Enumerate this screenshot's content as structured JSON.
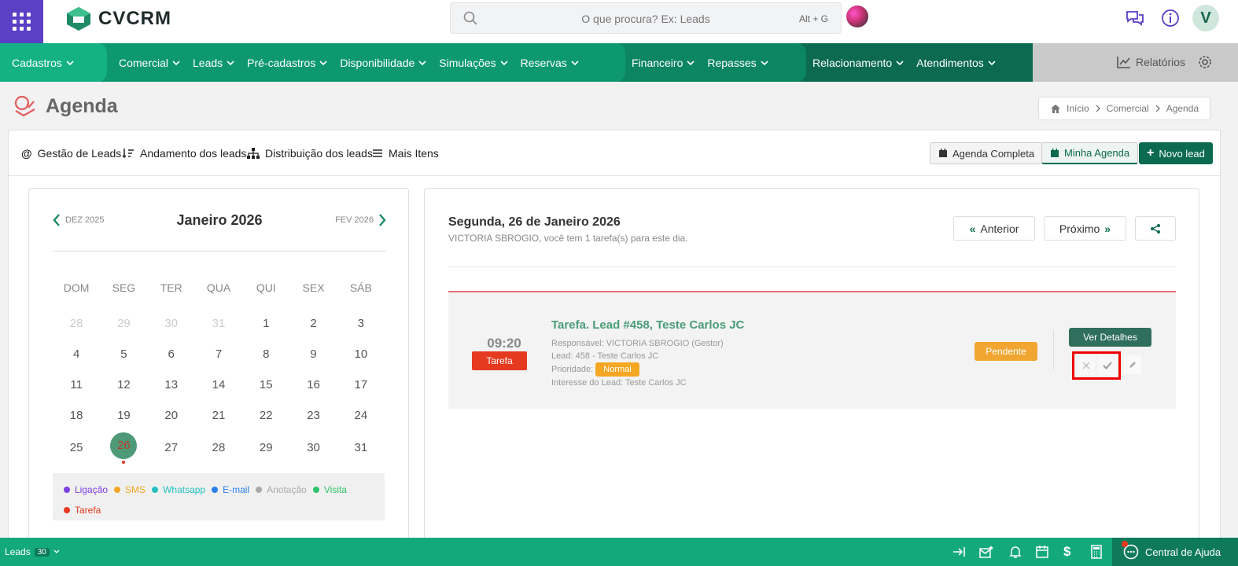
{
  "header": {
    "logo": "CVCRM",
    "search_placeholder": "O que procura? Ex: Leads",
    "search_shortcut": "Alt + G",
    "avatar_initial": "V"
  },
  "menu": {
    "items": [
      "Cadastros",
      "Comercial",
      "Leads",
      "Pré-cadastros",
      "Disponibilidade",
      "Simulações",
      "Reservas",
      "Financeiro",
      "Repasses",
      "Relacionamento",
      "Atendimentos"
    ],
    "reports": "Relatórios",
    "colors": {
      "green1": "#13b183",
      "green2": "#0e9870",
      "green3": "#0b6a50"
    }
  },
  "page": {
    "title": "Agenda",
    "breadcrumb": [
      "Início",
      "Comercial",
      "Agenda"
    ]
  },
  "subnav": {
    "items": [
      "Gestão de Leads",
      "Andamento dos leads",
      "Distribuição dos leads",
      "Mais Itens"
    ],
    "btn_full": "Agenda Completa",
    "btn_mine": "Minha Agenda",
    "btn_new": "Novo lead"
  },
  "calendar": {
    "prev": "DEZ 2025",
    "current": "Janeiro 2026",
    "next": "FEV 2026",
    "weekdays": [
      "DOM",
      "SEG",
      "TER",
      "QUA",
      "QUI",
      "SEX",
      "SÁB"
    ],
    "weeks": [
      [
        "28",
        "29",
        "30",
        "31",
        "1",
        "2",
        "3"
      ],
      [
        "4",
        "5",
        "6",
        "7",
        "8",
        "9",
        "10"
      ],
      [
        "11",
        "12",
        "13",
        "14",
        "15",
        "16",
        "17"
      ],
      [
        "18",
        "19",
        "20",
        "21",
        "22",
        "23",
        "24"
      ],
      [
        "25",
        "26",
        "27",
        "28",
        "29",
        "30",
        "31"
      ]
    ],
    "today": "26",
    "legend": [
      {
        "label": "Ligação",
        "color": "#7b3fe4"
      },
      {
        "label": "SMS",
        "color": "#f5a623"
      },
      {
        "label": "Whatsapp",
        "color": "#26bfbf"
      },
      {
        "label": "E-mail",
        "color": "#2a7fe6"
      },
      {
        "label": "Anotação",
        "color": "#aaaaaa"
      },
      {
        "label": "Visita",
        "color": "#2cc36b"
      },
      {
        "label": "Tarefa",
        "color": "#e53920"
      }
    ]
  },
  "agenda": {
    "date": "Segunda, 26 de Janeiro 2026",
    "subtitle": "VICTORIA SBROGIO, você tem 1 tarefa(s) para este dia.",
    "prev": "Anterior",
    "next": "Próximo",
    "task": {
      "time": "09:20",
      "type": "Tarefa",
      "title": "Tarefa. Lead #458, Teste Carlos JC",
      "responsavel": "Responsável: VICTORIA SBROGIO (Gestor)",
      "lead": "Lead: 458 - Teste Carlos JC",
      "prioridade_label": "Prioridade:",
      "prioridade": "Normal",
      "interesse": "Interesse do Lead: Teste Carlos JC",
      "status": "Pendente",
      "details": "Ver Detalhes"
    }
  },
  "bottom": {
    "leads_label": "Leads",
    "leads_count": "30",
    "help": "Central de Ajuda"
  }
}
